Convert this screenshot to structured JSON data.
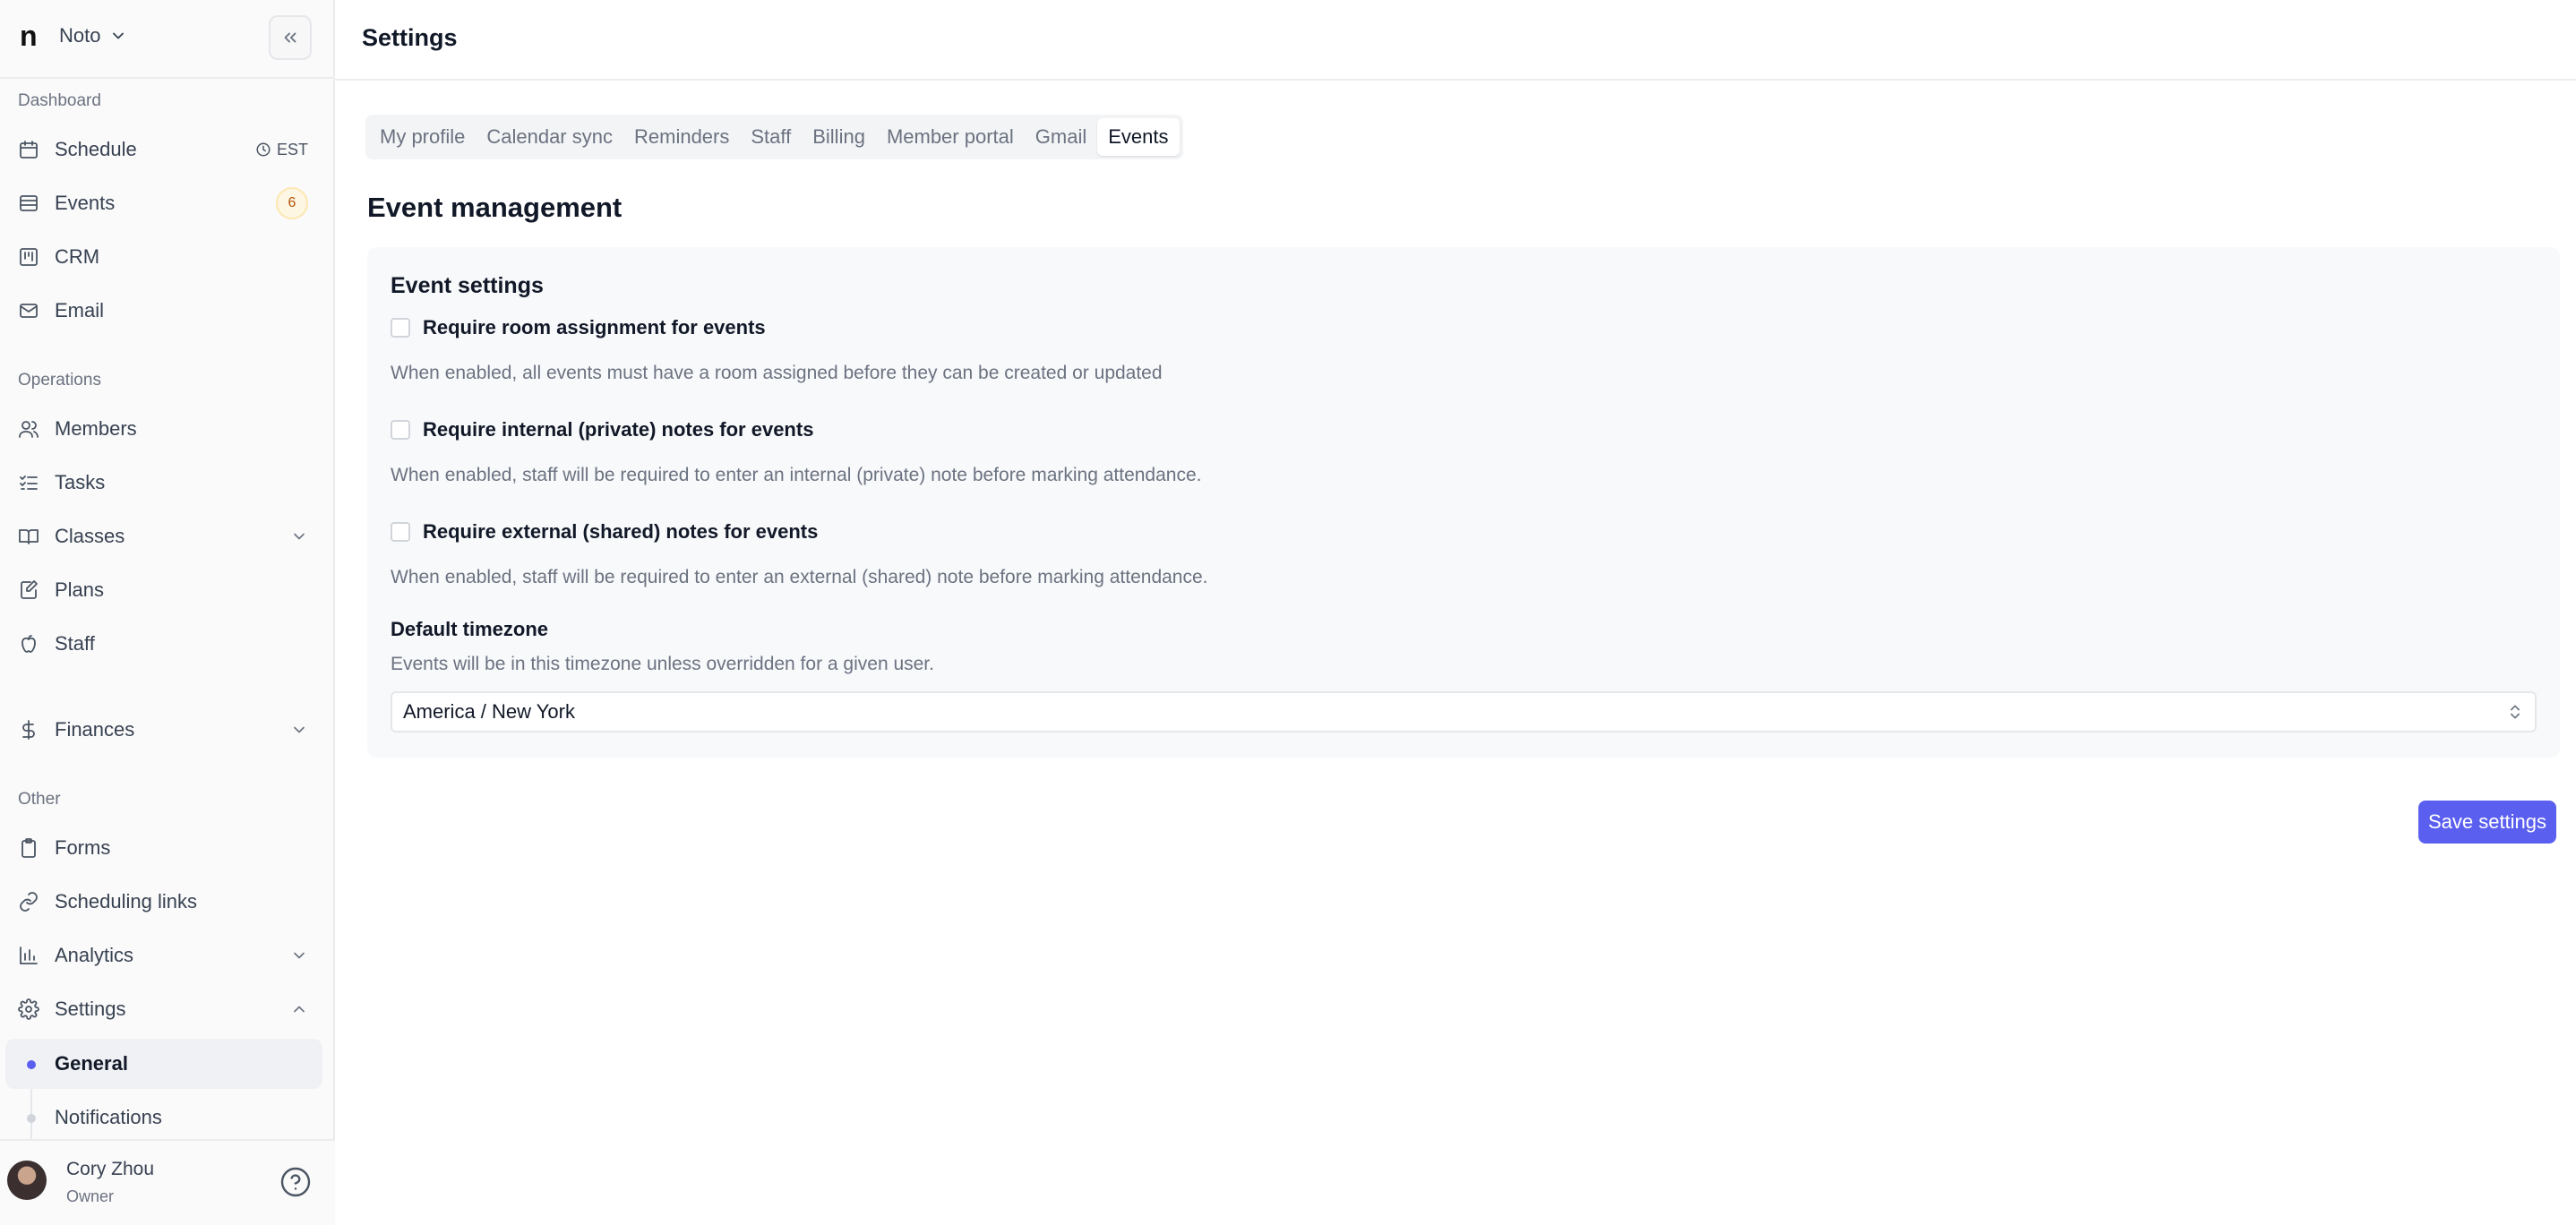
{
  "workspace": {
    "logo": "n",
    "name": "Noto"
  },
  "sidebar": {
    "sections": {
      "dashboard": "Dashboard",
      "operations": "Operations",
      "other": "Other"
    },
    "items": {
      "schedule": {
        "label": "Schedule",
        "tz": "EST"
      },
      "events": {
        "label": "Events",
        "badge": "6"
      },
      "crm": {
        "label": "CRM"
      },
      "email": {
        "label": "Email"
      },
      "members": {
        "label": "Members"
      },
      "tasks": {
        "label": "Tasks"
      },
      "classes": {
        "label": "Classes"
      },
      "plans": {
        "label": "Plans"
      },
      "staff": {
        "label": "Staff"
      },
      "finances": {
        "label": "Finances"
      },
      "forms": {
        "label": "Forms"
      },
      "scheduling_links": {
        "label": "Scheduling links"
      },
      "analytics": {
        "label": "Analytics"
      },
      "settings": {
        "label": "Settings"
      }
    },
    "settings_sub": {
      "general": "General",
      "notifications": "Notifications"
    }
  },
  "user": {
    "name": "Cory Zhou",
    "role": "Owner"
  },
  "header": {
    "title": "Settings"
  },
  "tabs": [
    {
      "label": "My profile"
    },
    {
      "label": "Calendar sync"
    },
    {
      "label": "Reminders"
    },
    {
      "label": "Staff"
    },
    {
      "label": "Billing"
    },
    {
      "label": "Member portal"
    },
    {
      "label": "Gmail"
    },
    {
      "label": "Events"
    }
  ],
  "active_tab": "Events",
  "content": {
    "section_title": "Event management",
    "card_title": "Event settings",
    "options": [
      {
        "label": "Require room assignment for events",
        "help": "When enabled, all events must have a room assigned before they can be created or updated",
        "checked": false
      },
      {
        "label": "Require internal (private) notes for events",
        "help": "When enabled, staff will be required to enter an internal (private) note before marking attendance.",
        "checked": false
      },
      {
        "label": "Require external (shared) notes for events",
        "help": "When enabled, staff will be required to enter an external (shared) note before marking attendance.",
        "checked": false
      }
    ],
    "timezone": {
      "label": "Default timezone",
      "help": "Events will be in this timezone unless overridden for a given user.",
      "value": "America / New York"
    },
    "save_label": "Save settings"
  },
  "colors": {
    "accent": "#5b5ff0",
    "badge_bg": "#fdf6e3",
    "badge_text": "#b45309"
  }
}
